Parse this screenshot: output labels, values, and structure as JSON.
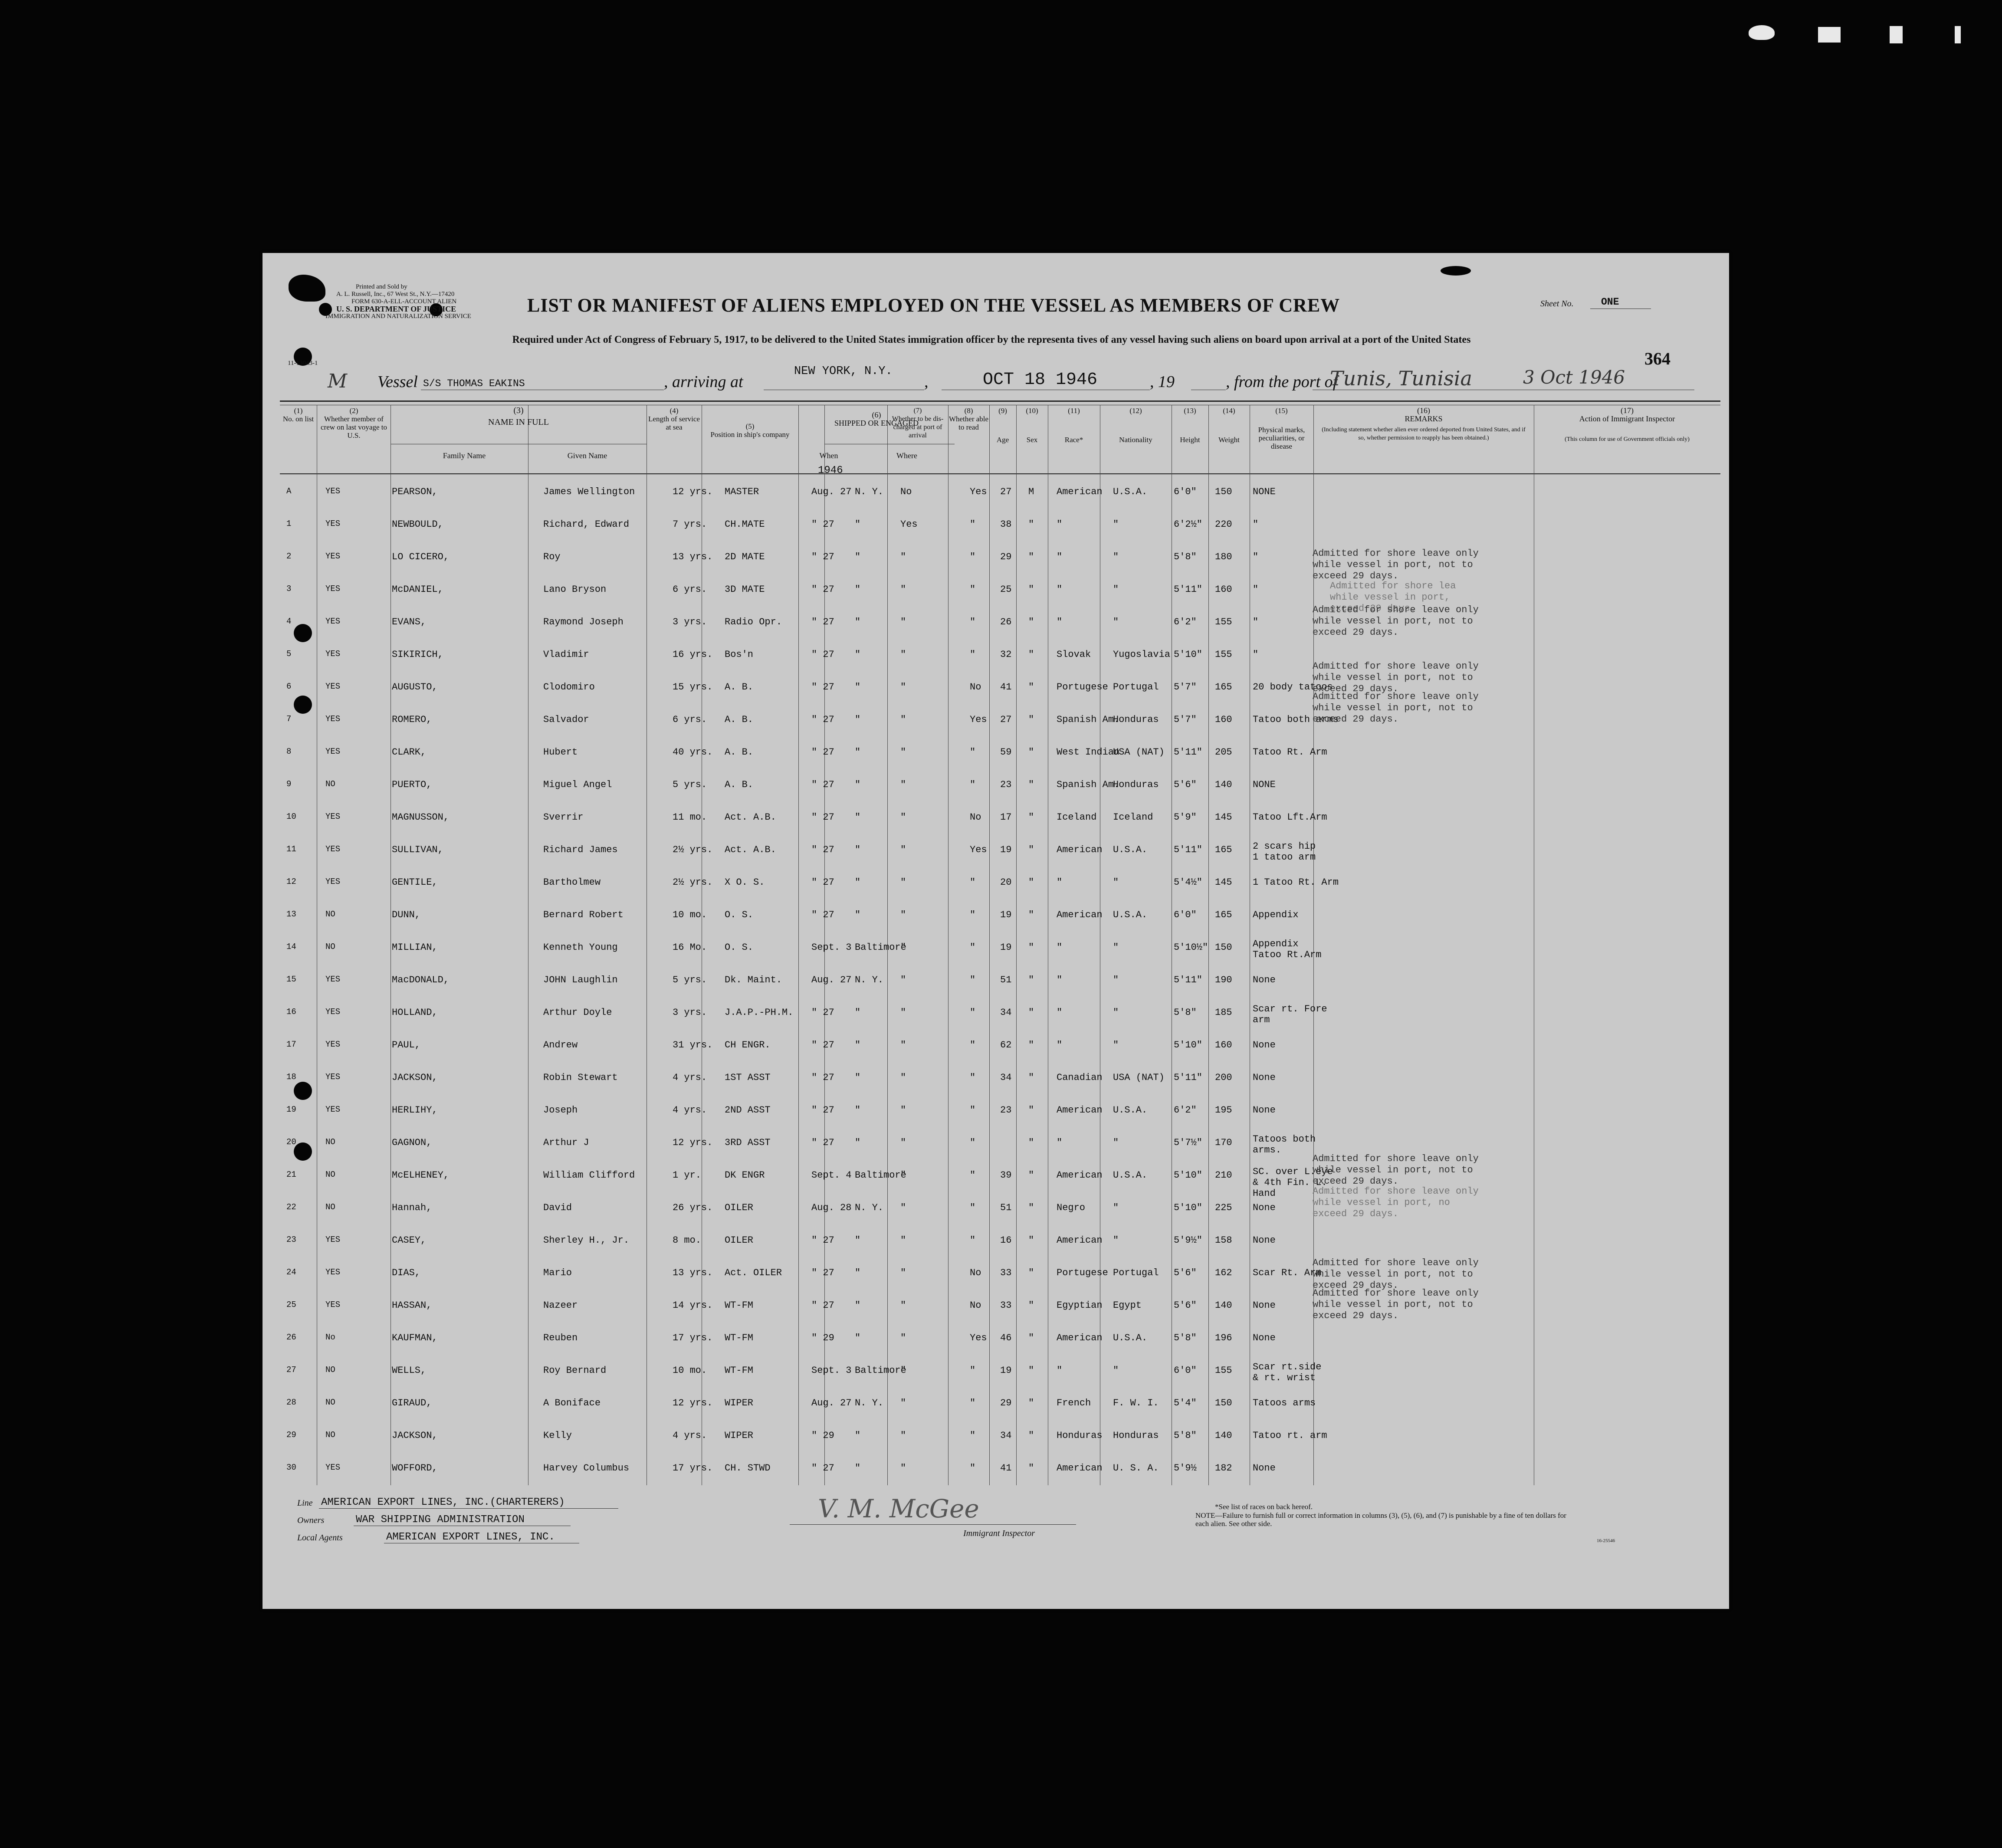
{
  "frame_marks": [
    "▼●",
    "▬",
    "¬",
    "ı"
  ],
  "form": {
    "printer_lines": [
      "Printed and Sold by",
      "A. L. Russell, Inc., 67 West St., N.Y.—17420",
      "FORM 630-A-ELL-ACCOUNT ALIEN",
      "U. S. DEPARTMENT OF JUSTICE",
      "IMMIGRATION AND NATURALIZATION SERVICE"
    ],
    "form_number": "11-13043-1",
    "title": "LIST OR MANIFEST OF ALIENS EMPLOYED ON THE VESSEL AS MEMBERS OF CREW",
    "sheet_label": "Sheet No.",
    "sheet_value": "ONE",
    "page_number": "364",
    "requirement": "Required under Act of Congress of February 5, 1917, to be delivered to the United States immigration officer by the representa tives of any vessel having such aliens on board upon arrival at a port of the United States",
    "vessel_label": "Vessel",
    "vessel_value": "S/S THOMAS EAKINS",
    "arriving_label": ", arriving at",
    "arriving_value": "NEW YORK, N.Y.",
    "date_value": "OCT 18 1946",
    "year_label": ", 19",
    "from_label": ", from the port of",
    "from_value": "Tunis, Tunisia",
    "from_date": "3 Oct 1946",
    "margin_note": "M"
  },
  "columns": [
    {
      "num": "(1)",
      "label": "No. on list"
    },
    {
      "num": "(2)",
      "label": "Whether member of crew on last voyage to U.S."
    },
    {
      "num": "(3)",
      "label": "NAME IN FULL"
    },
    {
      "num": "",
      "label": "Family Name"
    },
    {
      "num": "",
      "label": "Given Name"
    },
    {
      "num": "(4)",
      "label": "Length of service at sea"
    },
    {
      "num": "(5)",
      "label": "Position in ship's company"
    },
    {
      "num": "(6)",
      "label": "SHIPPED OR ENGAGED"
    },
    {
      "num": "",
      "label": "When"
    },
    {
      "num": "",
      "label": "Where"
    },
    {
      "num": "(7)",
      "label": "Whether to be dis-charged at port of arrival"
    },
    {
      "num": "(8)",
      "label": "Whether able to read"
    },
    {
      "num": "(9)",
      "label": "Age"
    },
    {
      "num": "(10)",
      "label": "Sex"
    },
    {
      "num": "(11)",
      "label": "Race*"
    },
    {
      "num": "(12)",
      "label": "Nationality"
    },
    {
      "num": "(13)",
      "label": "Height"
    },
    {
      "num": "(14)",
      "label": "Weight"
    },
    {
      "num": "(15)",
      "label": "Physical marks, peculiarities, or disease"
    },
    {
      "num": "(16)",
      "label": "REMARKS"
    },
    {
      "num": "",
      "label": "(Including statement whether alien ever ordered deported from United States, and if so, whether permission to reapply has been obtained.)"
    },
    {
      "num": "(17)",
      "label": "Action of Immigrant Inspector"
    },
    {
      "num": "",
      "label": "(This column for use of Government officials only)"
    }
  ],
  "when_year": "1946",
  "rows": [
    [
      "A",
      "YES",
      "PEARSON,",
      "James Wellington",
      "12 yrs.",
      "MASTER",
      "Aug. 27",
      "N. Y.",
      "No",
      "Yes",
      "27",
      "M",
      "American",
      "U.S.A.",
      "6'0\"",
      "150",
      "NONE"
    ],
    [
      "1",
      "YES",
      "NEWBOULD,",
      "Richard, Edward",
      "7 yrs.",
      "CH.MATE",
      "\" 27",
      "\"",
      "Yes",
      "\"",
      "38",
      "\"",
      "\"",
      "\"",
      "6'2½\"",
      "220",
      "\""
    ],
    [
      "2",
      "YES",
      "LO CICERO,",
      "Roy",
      "13 yrs.",
      "2D MATE",
      "\" 27",
      "\"",
      "\"",
      "\"",
      "29",
      "\"",
      "\"",
      "\"",
      "5'8\"",
      "180",
      "\""
    ],
    [
      "3",
      "YES",
      "McDANIEL,",
      "Lano Bryson",
      "6 yrs.",
      "3D MATE",
      "\" 27",
      "\"",
      "\"",
      "\"",
      "25",
      "\"",
      "\"",
      "\"",
      "5'11\"",
      "160",
      "\""
    ],
    [
      "4",
      "YES",
      "EVANS,",
      "Raymond Joseph",
      "3 yrs.",
      "Radio Opr.",
      "\" 27",
      "\"",
      "\"",
      "\"",
      "26",
      "\"",
      "\"",
      "\"",
      "6'2\"",
      "155",
      "\""
    ],
    [
      "5",
      "YES",
      "SIKIRICH,",
      "Vladimir",
      "16 yrs.",
      "Bos'n",
      "\" 27",
      "\"",
      "\"",
      "\"",
      "32",
      "\"",
      "Slovak",
      "Yugoslavia",
      "5'10\"",
      "155",
      "\""
    ],
    [
      "6",
      "YES",
      "AUGUSTO,",
      "Clodomiro",
      "15 yrs.",
      "A. B.",
      "\" 27",
      "\"",
      "\"",
      "No",
      "41",
      "\"",
      "Portugese",
      "Portugal",
      "5'7\"",
      "165",
      "20 body tatoos"
    ],
    [
      "7",
      "YES",
      "ROMERO,",
      "Salvador",
      "6 yrs.",
      "A. B.",
      "\" 27",
      "\"",
      "\"",
      "Yes",
      "27",
      "\"",
      "Spanish Am.",
      "Honduras",
      "5'7\"",
      "160",
      "Tatoo both arms"
    ],
    [
      "8",
      "YES",
      "CLARK,",
      "Hubert",
      "40 yrs.",
      "A. B.",
      "\" 27",
      "\"",
      "\"",
      "\"",
      "59",
      "\"",
      "West Indian",
      "USA (NAT)",
      "5'11\"",
      "205",
      "Tatoo Rt. Arm"
    ],
    [
      "9",
      "NO",
      "PUERTO,",
      "Miguel Angel",
      "5 yrs.",
      "A. B.",
      "\" 27",
      "\"",
      "\"",
      "\"",
      "23",
      "\"",
      "Spanish Am.",
      "Honduras",
      "5'6\"",
      "140",
      "NONE"
    ],
    [
      "10",
      "YES",
      "MAGNUSSON,",
      "Sverrir",
      "11 mo.",
      "Act. A.B.",
      "\" 27",
      "\"",
      "\"",
      "No",
      "17",
      "\"",
      "Iceland",
      "Iceland",
      "5'9\"",
      "145",
      "Tatoo Lft.Arm"
    ],
    [
      "11",
      "YES",
      "SULLIVAN,",
      "Richard James",
      "2½ yrs.",
      "Act. A.B.",
      "\" 27",
      "\"",
      "\"",
      "Yes",
      "19",
      "\"",
      "American",
      "U.S.A.",
      "5'11\"",
      "165",
      "2 scars hip|1 tatoo arm"
    ],
    [
      "12",
      "YES",
      "GENTILE,",
      "Bartholmew",
      "2½ yrs.",
      "X O. S.",
      "\" 27",
      "\"",
      "\"",
      "\"",
      "20",
      "\"",
      "\"",
      "\"",
      "5'4½\"",
      "145",
      "1 Tatoo Rt. Arm"
    ],
    [
      "13",
      "NO",
      "DUNN,",
      "Bernard Robert",
      "10 mo.",
      "O. S.",
      "\" 27",
      "\"",
      "\"",
      "\"",
      "19",
      "\"",
      "American",
      "U.S.A.",
      "6'0\"",
      "165",
      "Appendix"
    ],
    [
      "14",
      "NO",
      "MILLIAN,",
      "Kenneth Young",
      "16 Mo.",
      "O. S.",
      "Sept. 3",
      "Baltimore",
      "\"",
      "\"",
      "19",
      "\"",
      "\"",
      "\"",
      "5'10½\"",
      "150",
      "Appendix|Tatoo Rt.Arm"
    ],
    [
      "15",
      "YES",
      "MacDONALD,",
      "JOHN Laughlin",
      "5 yrs.",
      "Dk. Maint.",
      "Aug. 27",
      "N. Y.",
      "\"",
      "\"",
      "51",
      "\"",
      "\"",
      "\"",
      "5'11\"",
      "190",
      "None"
    ],
    [
      "16",
      "YES",
      "HOLLAND,",
      "Arthur Doyle",
      "3 yrs.",
      "J.A.P.-PH.M.",
      "\" 27",
      "\"",
      "\"",
      "\"",
      "34",
      "\"",
      "\"",
      "\"",
      "5'8\"",
      "185",
      "Scar rt. Fore|arm"
    ],
    [
      "17",
      "YES",
      "PAUL,",
      "Andrew",
      "31 yrs.",
      "CH ENGR.",
      "\" 27",
      "\"",
      "\"",
      "\"",
      "62",
      "\"",
      "\"",
      "\"",
      "5'10\"",
      "160",
      "None"
    ],
    [
      "18",
      "YES",
      "JACKSON,",
      "Robin Stewart",
      "4 yrs.",
      "1ST ASST",
      "\" 27",
      "\"",
      "\"",
      "\"",
      "34",
      "\"",
      "Canadian",
      "USA (NAT)",
      "5'11\"",
      "200",
      "None"
    ],
    [
      "19",
      "YES",
      "HERLIHY,",
      "Joseph",
      "4 yrs.",
      "2ND ASST",
      "\" 27",
      "\"",
      "\"",
      "\"",
      "23",
      "\"",
      "American",
      "U.S.A.",
      "6'2\"",
      "195",
      "None"
    ],
    [
      "20",
      "NO",
      "GAGNON,",
      "Arthur J",
      "12 yrs.",
      "3RD ASST",
      "\" 27",
      "\"",
      "\"",
      "\"",
      "",
      "\"",
      "\"",
      "\"",
      "5'7½\"",
      "170",
      "Tatoos both|arms."
    ],
    [
      "21",
      "NO",
      "McELHENEY,",
      "William Clifford",
      "1 yr.",
      "DK ENGR",
      "Sept. 4",
      "Baltimore",
      "\"",
      "\"",
      "39",
      "\"",
      "American",
      "U.S.A.",
      "5'10\"",
      "210",
      "SC. over L.eye|& 4th Fin. L.|Hand"
    ],
    [
      "22",
      "NO",
      "Hannah,",
      "David",
      "26 yrs.",
      "OILER",
      "Aug. 28",
      "N. Y.",
      "\"",
      "\"",
      "51",
      "\"",
      "Negro",
      "\"",
      "5'10\"",
      "225",
      "None"
    ],
    [
      "23",
      "YES",
      "CASEY,",
      "Sherley H., Jr.",
      "8 mo.",
      "OILER",
      "\" 27",
      "\"",
      "\"",
      "\"",
      "16",
      "\"",
      "American",
      "\"",
      "5'9½\"",
      "158",
      "None"
    ],
    [
      "24",
      "YES",
      "DIAS,",
      "Mario",
      "13 yrs.",
      "Act. OILER",
      "\" 27",
      "\"",
      "\"",
      "No",
      "33",
      "\"",
      "Portugese",
      "Portugal",
      "5'6\"",
      "162",
      "Scar Rt. Arm"
    ],
    [
      "25",
      "YES",
      "HASSAN,",
      "Nazeer",
      "14 yrs.",
      "WT-FM",
      "\" 27",
      "\"",
      "\"",
      "No",
      "33",
      "\"",
      "Egyptian",
      "Egypt",
      "5'6\"",
      "140",
      "None"
    ],
    [
      "26",
      "No",
      "KAUFMAN,",
      "Reuben",
      "17 yrs.",
      "WT-FM",
      "\" 29",
      "\"",
      "\"",
      "Yes",
      "46",
      "\"",
      "American",
      "U.S.A.",
      "5'8\"",
      "196",
      "None"
    ],
    [
      "27",
      "NO",
      "WELLS,",
      "Roy Bernard",
      "10 mo.",
      "WT-FM",
      "Sept. 3",
      "Baltimore",
      "\"",
      "\"",
      "19",
      "\"",
      "\"",
      "\"",
      "6'0\"",
      "155",
      "Scar rt.side|& rt. wrist"
    ],
    [
      "28",
      "NO",
      "GIRAUD,",
      "A Boniface",
      "12 yrs.",
      "WIPER",
      "Aug. 27",
      "N. Y.",
      "\"",
      "\"",
      "29",
      "\"",
      "French",
      "F. W. I.",
      "5'4\"",
      "150",
      "Tatoos arms"
    ],
    [
      "29",
      "NO",
      "JACKSON,",
      "Kelly",
      "4 yrs.",
      "WIPER",
      "\" 29",
      "\"",
      "\"",
      "\"",
      "34",
      "\"",
      "Honduras",
      "Honduras",
      "5'8\"",
      "140",
      "Tatoo rt. arm"
    ],
    [
      "30",
      "YES",
      "WOFFORD,",
      "Harvey Columbus",
      "17 yrs.",
      "CH. STWD",
      "\" 27",
      "\"",
      "\"",
      "\"",
      "41",
      "\"",
      "American",
      "U. S. A.",
      "5'9½",
      "182",
      "None"
    ]
  ],
  "remarks": [
    "Admitted for shore leave only\nwhile vessel in port, not to\nexceed 29 days.",
    "Admitted for shore lea\nwhile vessel in port,\nexceed 29 days.",
    "Admitted for shore leave only\nwhile vessel in port, not to\nexceed 29 days.",
    "Admitted for shore leave only\nwhile vessel in port, not to\nexceed 29 days.",
    "Admitted for shore leave only\nwhile vessel in port, not to\nexceed 29 days.",
    "Admitted for shore leave only\nwhile vessel in port, not to\nexceed 29 days.",
    "Admitted for shore leave only\nwhile vessel in port, no\nexceed 29 days.",
    "Admitted for shore leave only\nwhile vessel in port, not to\nexceed 29 days.",
    "Admitted for shore leave only\nwhile vessel in port, not to\nexceed 29 days."
  ],
  "footer": {
    "line_label": "Line",
    "line_value": "AMERICAN EXPORT LINES, INC.(CHARTERERS)",
    "owners_label": "Owners",
    "owners_value": "WAR SHIPPING ADMINISTRATION",
    "agents_label": "Local Agents",
    "agents_value": "AMERICAN EXPORT LINES, INC.",
    "signature": "V. M. McGee",
    "inspector_label": "Immigrant Inspector",
    "race_note": "*See list of races on back hereof.",
    "note": "NOTE—Failure to furnish full or correct information in columns (3), (5), (6), and (7) is punishable by a fine of ten dollars for each alien. See other side.",
    "code": "16-25546"
  }
}
